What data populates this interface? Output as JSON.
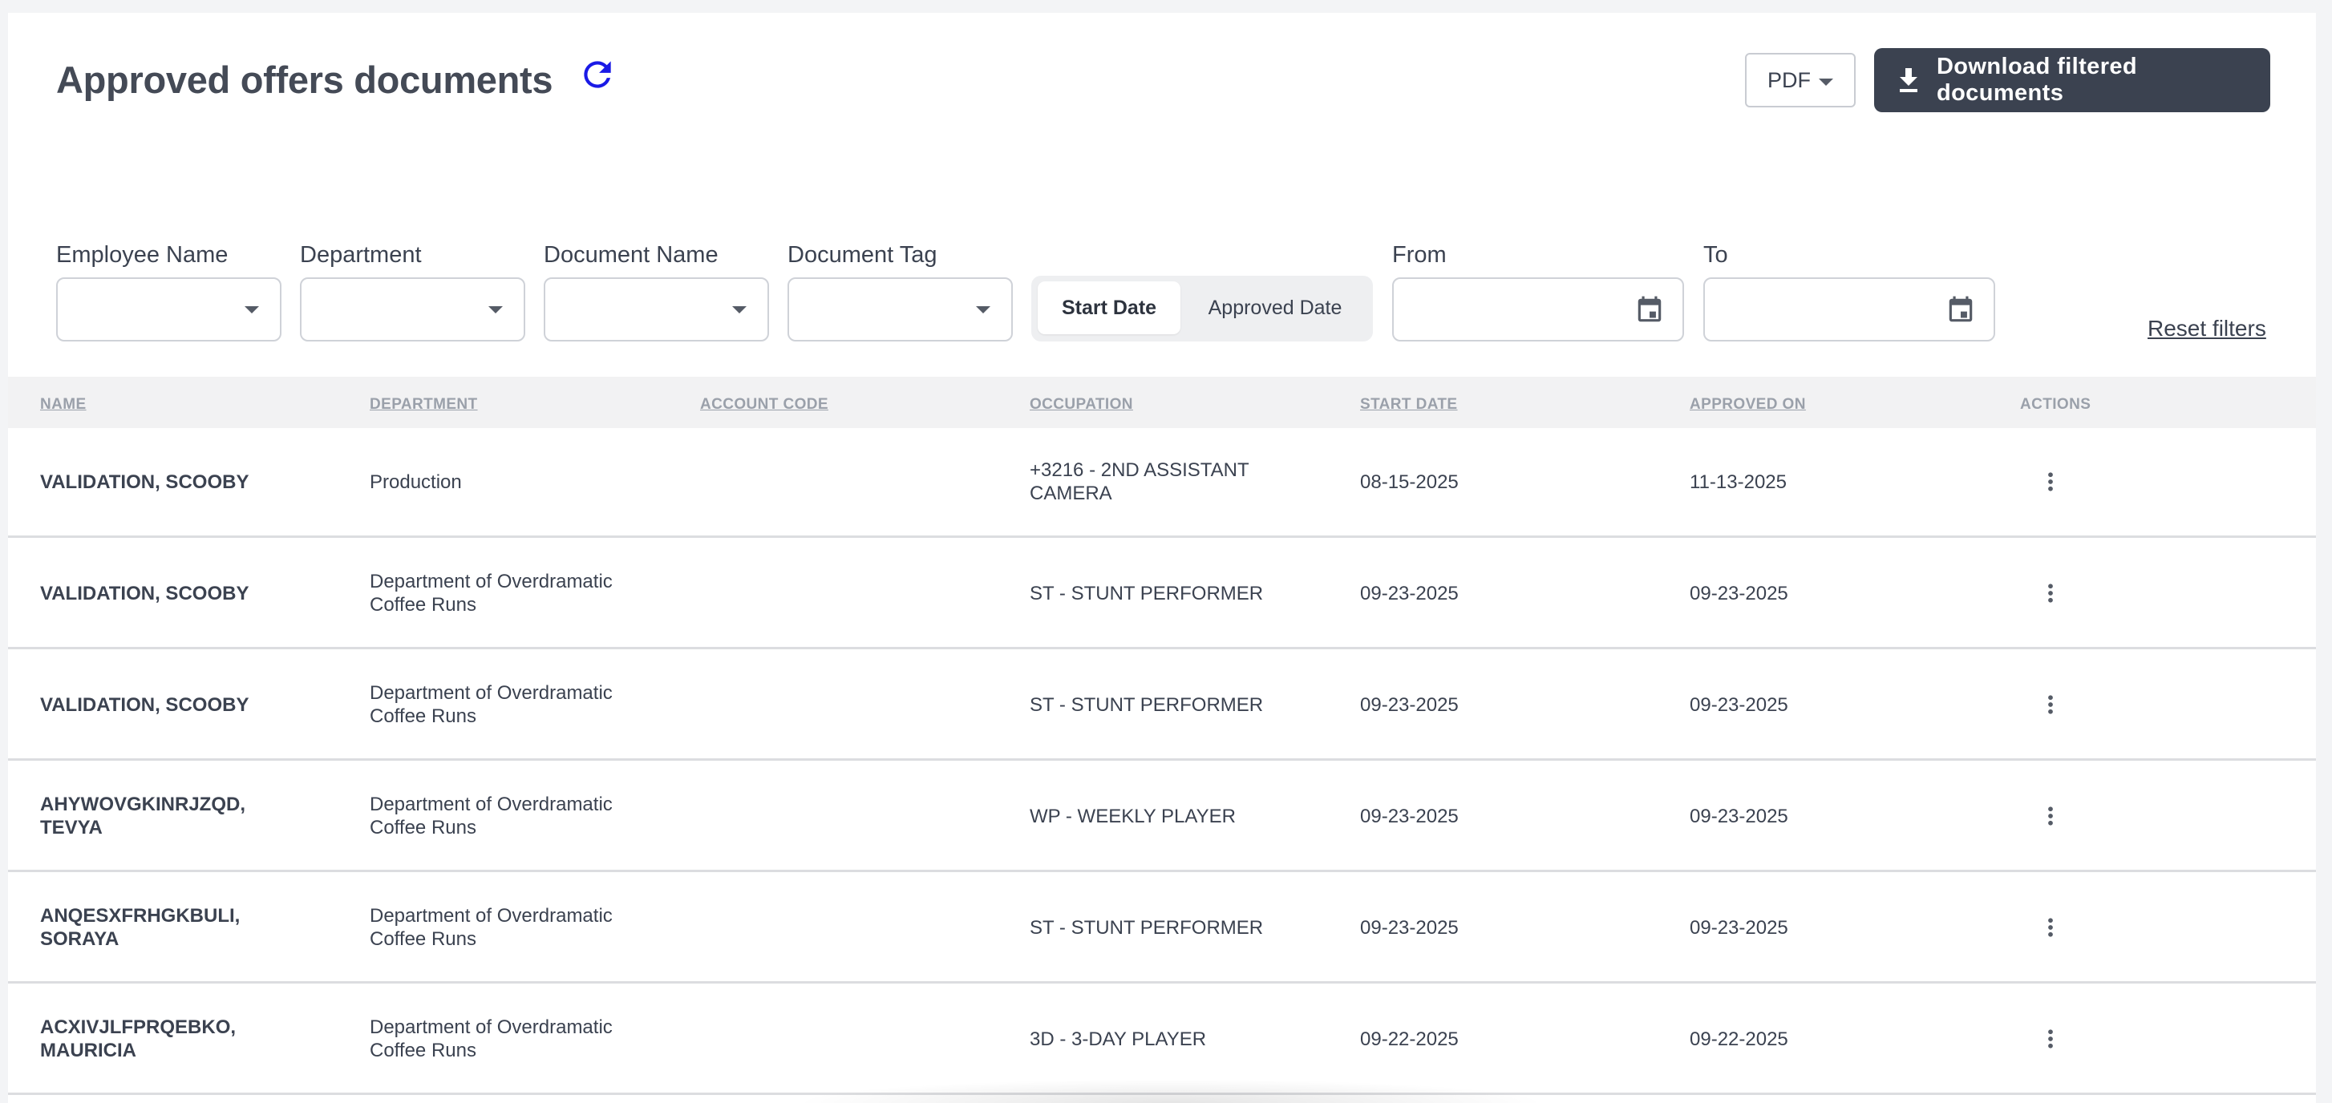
{
  "header": {
    "title": "Approved offers documents",
    "format_value": "PDF",
    "download_label": "Download filtered documents"
  },
  "filters": {
    "employee_name_label": "Employee Name",
    "department_label": "Department",
    "document_name_label": "Document Name",
    "document_tag_label": "Document Tag",
    "toggle_active": "Start Date",
    "toggle_inactive": "Approved Date",
    "from_label": "From",
    "to_label": "To",
    "reset_label": "Reset filters"
  },
  "table": {
    "columns": [
      "NAME",
      "DEPARTMENT",
      "ACCOUNT CODE",
      "OCCUPATION",
      "START DATE",
      "APPROVED ON",
      "ACTIONS"
    ],
    "rows": [
      {
        "name": "VALIDATION, SCOOBY",
        "department": "Production",
        "account_code": "",
        "occupation": "+3216 - 2ND ASSISTANT CAMERA",
        "start_date": "08-15-2025",
        "approved_on": "11-13-2025"
      },
      {
        "name": "VALIDATION, SCOOBY",
        "department": "Department of Overdramatic Coffee Runs",
        "account_code": "",
        "occupation": "ST - STUNT PERFORMER",
        "start_date": "09-23-2025",
        "approved_on": "09-23-2025"
      },
      {
        "name": "VALIDATION, SCOOBY",
        "department": "Department of Overdramatic Coffee Runs",
        "account_code": "",
        "occupation": "ST - STUNT PERFORMER",
        "start_date": "09-23-2025",
        "approved_on": "09-23-2025"
      },
      {
        "name": "AHYWOVGKINRJZQD, TEVYA",
        "department": "Department of Overdramatic Coffee Runs",
        "account_code": "",
        "occupation": "WP - WEEKLY PLAYER",
        "start_date": "09-23-2025",
        "approved_on": "09-23-2025"
      },
      {
        "name": "ANQESXFRHGKBULI, SORAYA",
        "department": "Department of Overdramatic Coffee Runs",
        "account_code": "",
        "occupation": "ST - STUNT PERFORMER",
        "start_date": "09-23-2025",
        "approved_on": "09-23-2025"
      },
      {
        "name": "ACXIVJLFPRQEBKO, MAURICIA",
        "department": "Department of Overdramatic Coffee Runs",
        "account_code": "",
        "occupation": "3D - 3-DAY PLAYER",
        "start_date": "09-22-2025",
        "approved_on": "09-22-2025"
      }
    ]
  },
  "icons": {
    "refresh": "refresh-icon",
    "download": "download-icon",
    "caret": "caret-down-icon",
    "calendar": "calendar-icon",
    "actions": "more-vertical-icon"
  },
  "colors": {
    "primary_button": "#3b4250",
    "refresh_icon": "#1a1ae6",
    "header_bg": "#f2f2f3"
  }
}
